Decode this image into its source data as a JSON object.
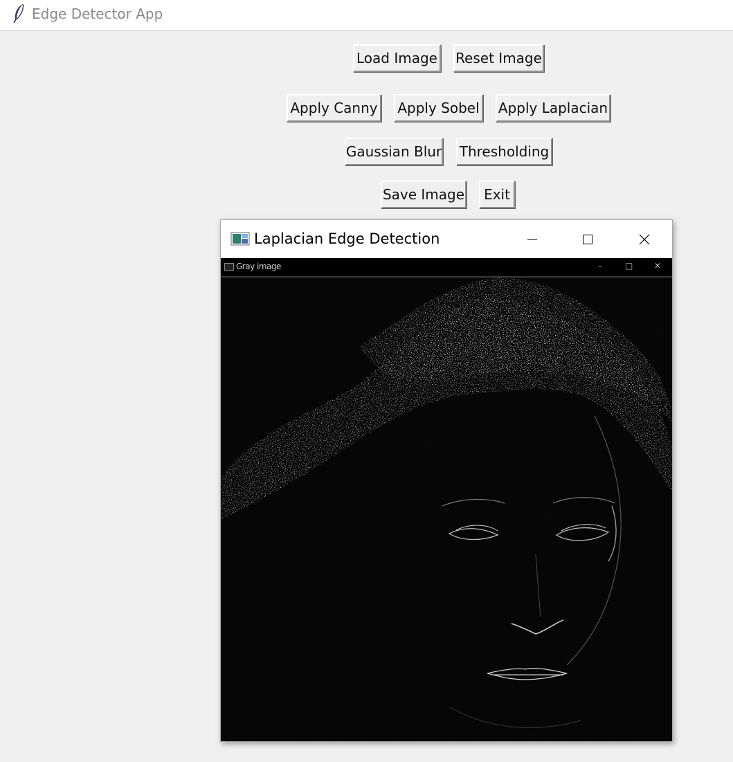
{
  "app": {
    "title": "Edge Detector App",
    "icon": "feather-icon"
  },
  "buttons": {
    "load": "Load Image",
    "reset": "Reset Image",
    "canny": "Apply Canny",
    "sobel": "Apply Sobel",
    "laplacian": "Apply Laplacian",
    "gaussian": "Gaussian Blur",
    "threshold": "Thresholding",
    "save": "Save Image",
    "exit": "Exit"
  },
  "result_window": {
    "title": "Laplacian Edge Detection",
    "icon": "image-window-icon",
    "controls": [
      "minimize-icon",
      "maximize-icon",
      "close-icon"
    ],
    "inner_title": "Gray image",
    "inner_controls": [
      "–",
      "□",
      "✕"
    ]
  },
  "colors": {
    "background": "#f0f0f0",
    "image_background": "#000000",
    "edge_color": "#ffffff"
  }
}
